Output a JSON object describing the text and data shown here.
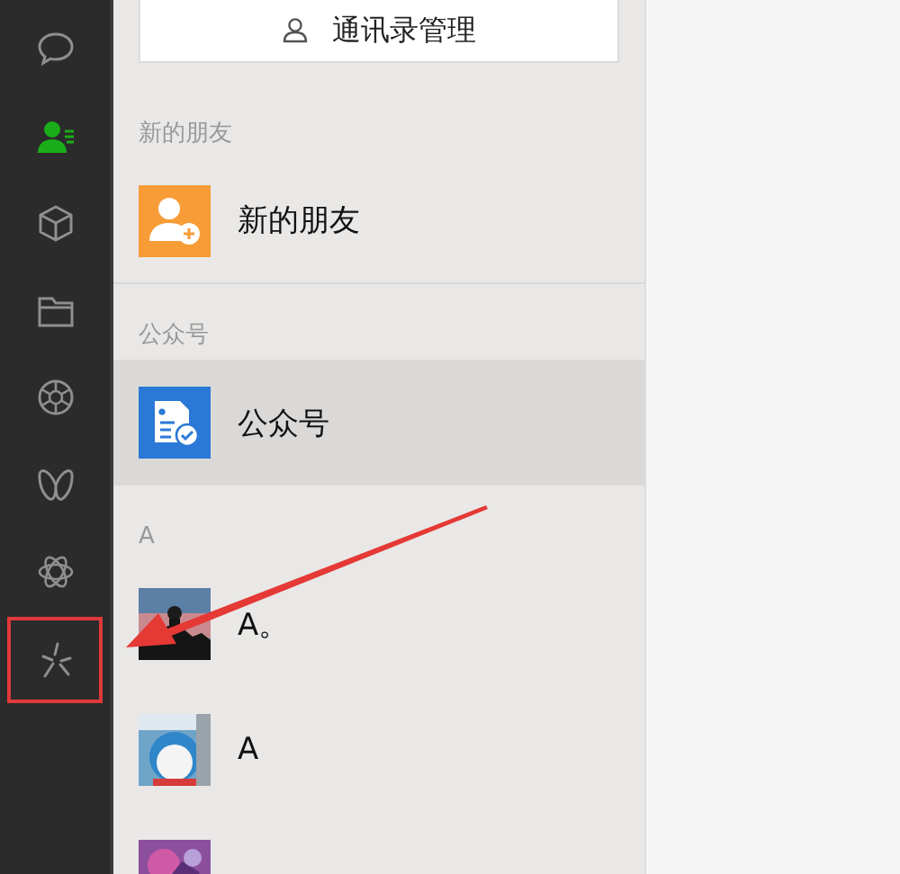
{
  "sidebar": {
    "items": [
      {
        "kind": "chat",
        "selected": false
      },
      {
        "kind": "contacts",
        "selected": true
      },
      {
        "kind": "cube",
        "selected": false
      },
      {
        "kind": "folder",
        "selected": false
      },
      {
        "kind": "aperture",
        "selected": false
      },
      {
        "kind": "butterfly",
        "selected": false
      },
      {
        "kind": "orbit",
        "selected": false
      },
      {
        "kind": "sparkle",
        "selected": false,
        "highlighted": true
      }
    ]
  },
  "manage_button": {
    "label": "通讯录管理"
  },
  "sections": [
    {
      "header": "新的朋友",
      "items": [
        {
          "name": "新的朋友",
          "kind": "new-friend",
          "selected": false
        }
      ]
    },
    {
      "header": "公众号",
      "items": [
        {
          "name": "公众号",
          "kind": "official-account",
          "selected": true
        }
      ]
    },
    {
      "header": "A",
      "items": [
        {
          "name": "A。",
          "kind": "picture",
          "selected": false
        },
        {
          "name": "A",
          "kind": "picture",
          "selected": false
        },
        {
          "kind": "picture",
          "selected": false
        }
      ]
    }
  ],
  "annotation": {
    "kind": "arrow"
  }
}
